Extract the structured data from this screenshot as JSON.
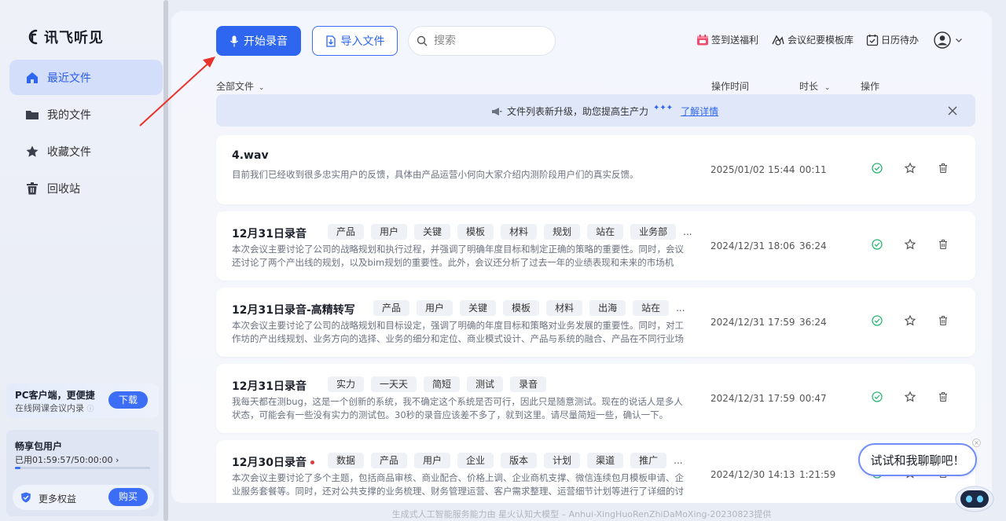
{
  "brand": {
    "name": "讯飞听见"
  },
  "sidebar": {
    "items": [
      {
        "label": "最近文件",
        "icon": "home-icon",
        "active": true
      },
      {
        "label": "我的文件",
        "icon": "folder-icon",
        "active": false
      },
      {
        "label": "收藏文件",
        "icon": "star-icon",
        "active": false
      },
      {
        "label": "回收站",
        "icon": "trash-icon",
        "active": false
      }
    ],
    "pc_card": {
      "title": "PC客户端，更便捷",
      "subtitle": "在线网课会议内录",
      "button": "下载"
    },
    "package": {
      "title": "畅享包用户",
      "usage": "已用01:59:57/50:00:00 ›",
      "usage_fraction": 0.04,
      "more": "更多权益",
      "buy": "购买"
    }
  },
  "toolbar": {
    "record_label": "开始录音",
    "import_label": "导入文件",
    "search_placeholder": "搜索",
    "links": [
      {
        "label": "签到送福利",
        "icon": "calendar-gift-icon"
      },
      {
        "label": "会议纪要模板库",
        "icon": "template-icon"
      },
      {
        "label": "日历待办",
        "icon": "calendar-check-icon"
      }
    ]
  },
  "columns": {
    "all_files": "全部文件",
    "op_time": "操作时间",
    "duration": "时长",
    "actions": "操作"
  },
  "notice": {
    "text": "文件列表新升级，助您提高生产力",
    "link": "了解详情"
  },
  "files": [
    {
      "title": "4.wav",
      "tags": [],
      "summary": "目前我们已经收到很多忠实用户的反馈，具体由产品运营小何向大家介绍内测阶段用户们的真实反馈。",
      "time": "2025/01/02 15:44",
      "duration": "00:11",
      "unread": false
    },
    {
      "title": "12月31日录音",
      "tags": [
        "产品",
        "用户",
        "关键",
        "模板",
        "材料",
        "规划",
        "站在",
        "业务部"
      ],
      "summary": "本次会议主要讨论了公司的战略规划和执行过程，并强调了明确年度目标和制定正确的策略的重要性。同时，会议还讨论了两个产出线的规划，以及bim规划的重要性。此外，会议还分析了过去一年的业绩表现和未来的市场机会，...",
      "time": "2024/12/31 18:06",
      "duration": "36:24",
      "unread": false
    },
    {
      "title": "12月31日录音-高精转写",
      "tags": [
        "产品",
        "用户",
        "关键",
        "模板",
        "材料",
        "出海",
        "站在"
      ],
      "summary": "本次会议主要讨论了公司的战略规划和目标设定，强调了明确的年度目标和策略对业务发展的重要性。同时，对工作坊的产出线规划、业务方向的选择、业务的细分和定位、商业模式设计、产品与系统的融合、产品在不同行业场景...",
      "time": "2024/12/31 17:59",
      "duration": "36:24",
      "unread": false
    },
    {
      "title": "12月31日录音",
      "tags": [
        "实力",
        "一天天",
        "简短",
        "测试",
        "录音"
      ],
      "summary": "我每天都在测bug，这是一个创新的系统，我不确定这个系统是否可行，因此只是随意测试。现在的说话人是多人状态，可能会有一些没有实力的测试包。30秒的录音应该差不多了，就到这里。请尽量简短一些，确认一下。",
      "time": "2024/12/31 17:59",
      "duration": "00:47",
      "unread": false
    },
    {
      "title": "12月30日录音",
      "tags": [
        "数据",
        "产品",
        "用户",
        "企业",
        "版本",
        "计划",
        "渠道",
        "推广"
      ],
      "summary": "本次会议主要讨论了多个主题，包括商品审核、商业配合、价格上调、企业商机支撑、微信连续包月模板申请、企业服务套餐等。同时，还对公共支撑的业务梳理、财务管理运营、客户需求整理、运营细节计划等进行了详细的讨论...",
      "time": "2024/12/30 14:13",
      "duration": "1:21:59",
      "unread": true
    }
  ],
  "footer": "生成式人工智能服务能力由 星火认知大模型 – Anhui-XingHuoRenZhiDaMoXing-20230823提供",
  "assistant": {
    "bubble": "试试和我聊聊吧！"
  },
  "colors": {
    "accent": "#2e66f0",
    "active_bg": "#d3dffa",
    "success": "#2bb673",
    "unread_dot": "#e23a3a"
  }
}
